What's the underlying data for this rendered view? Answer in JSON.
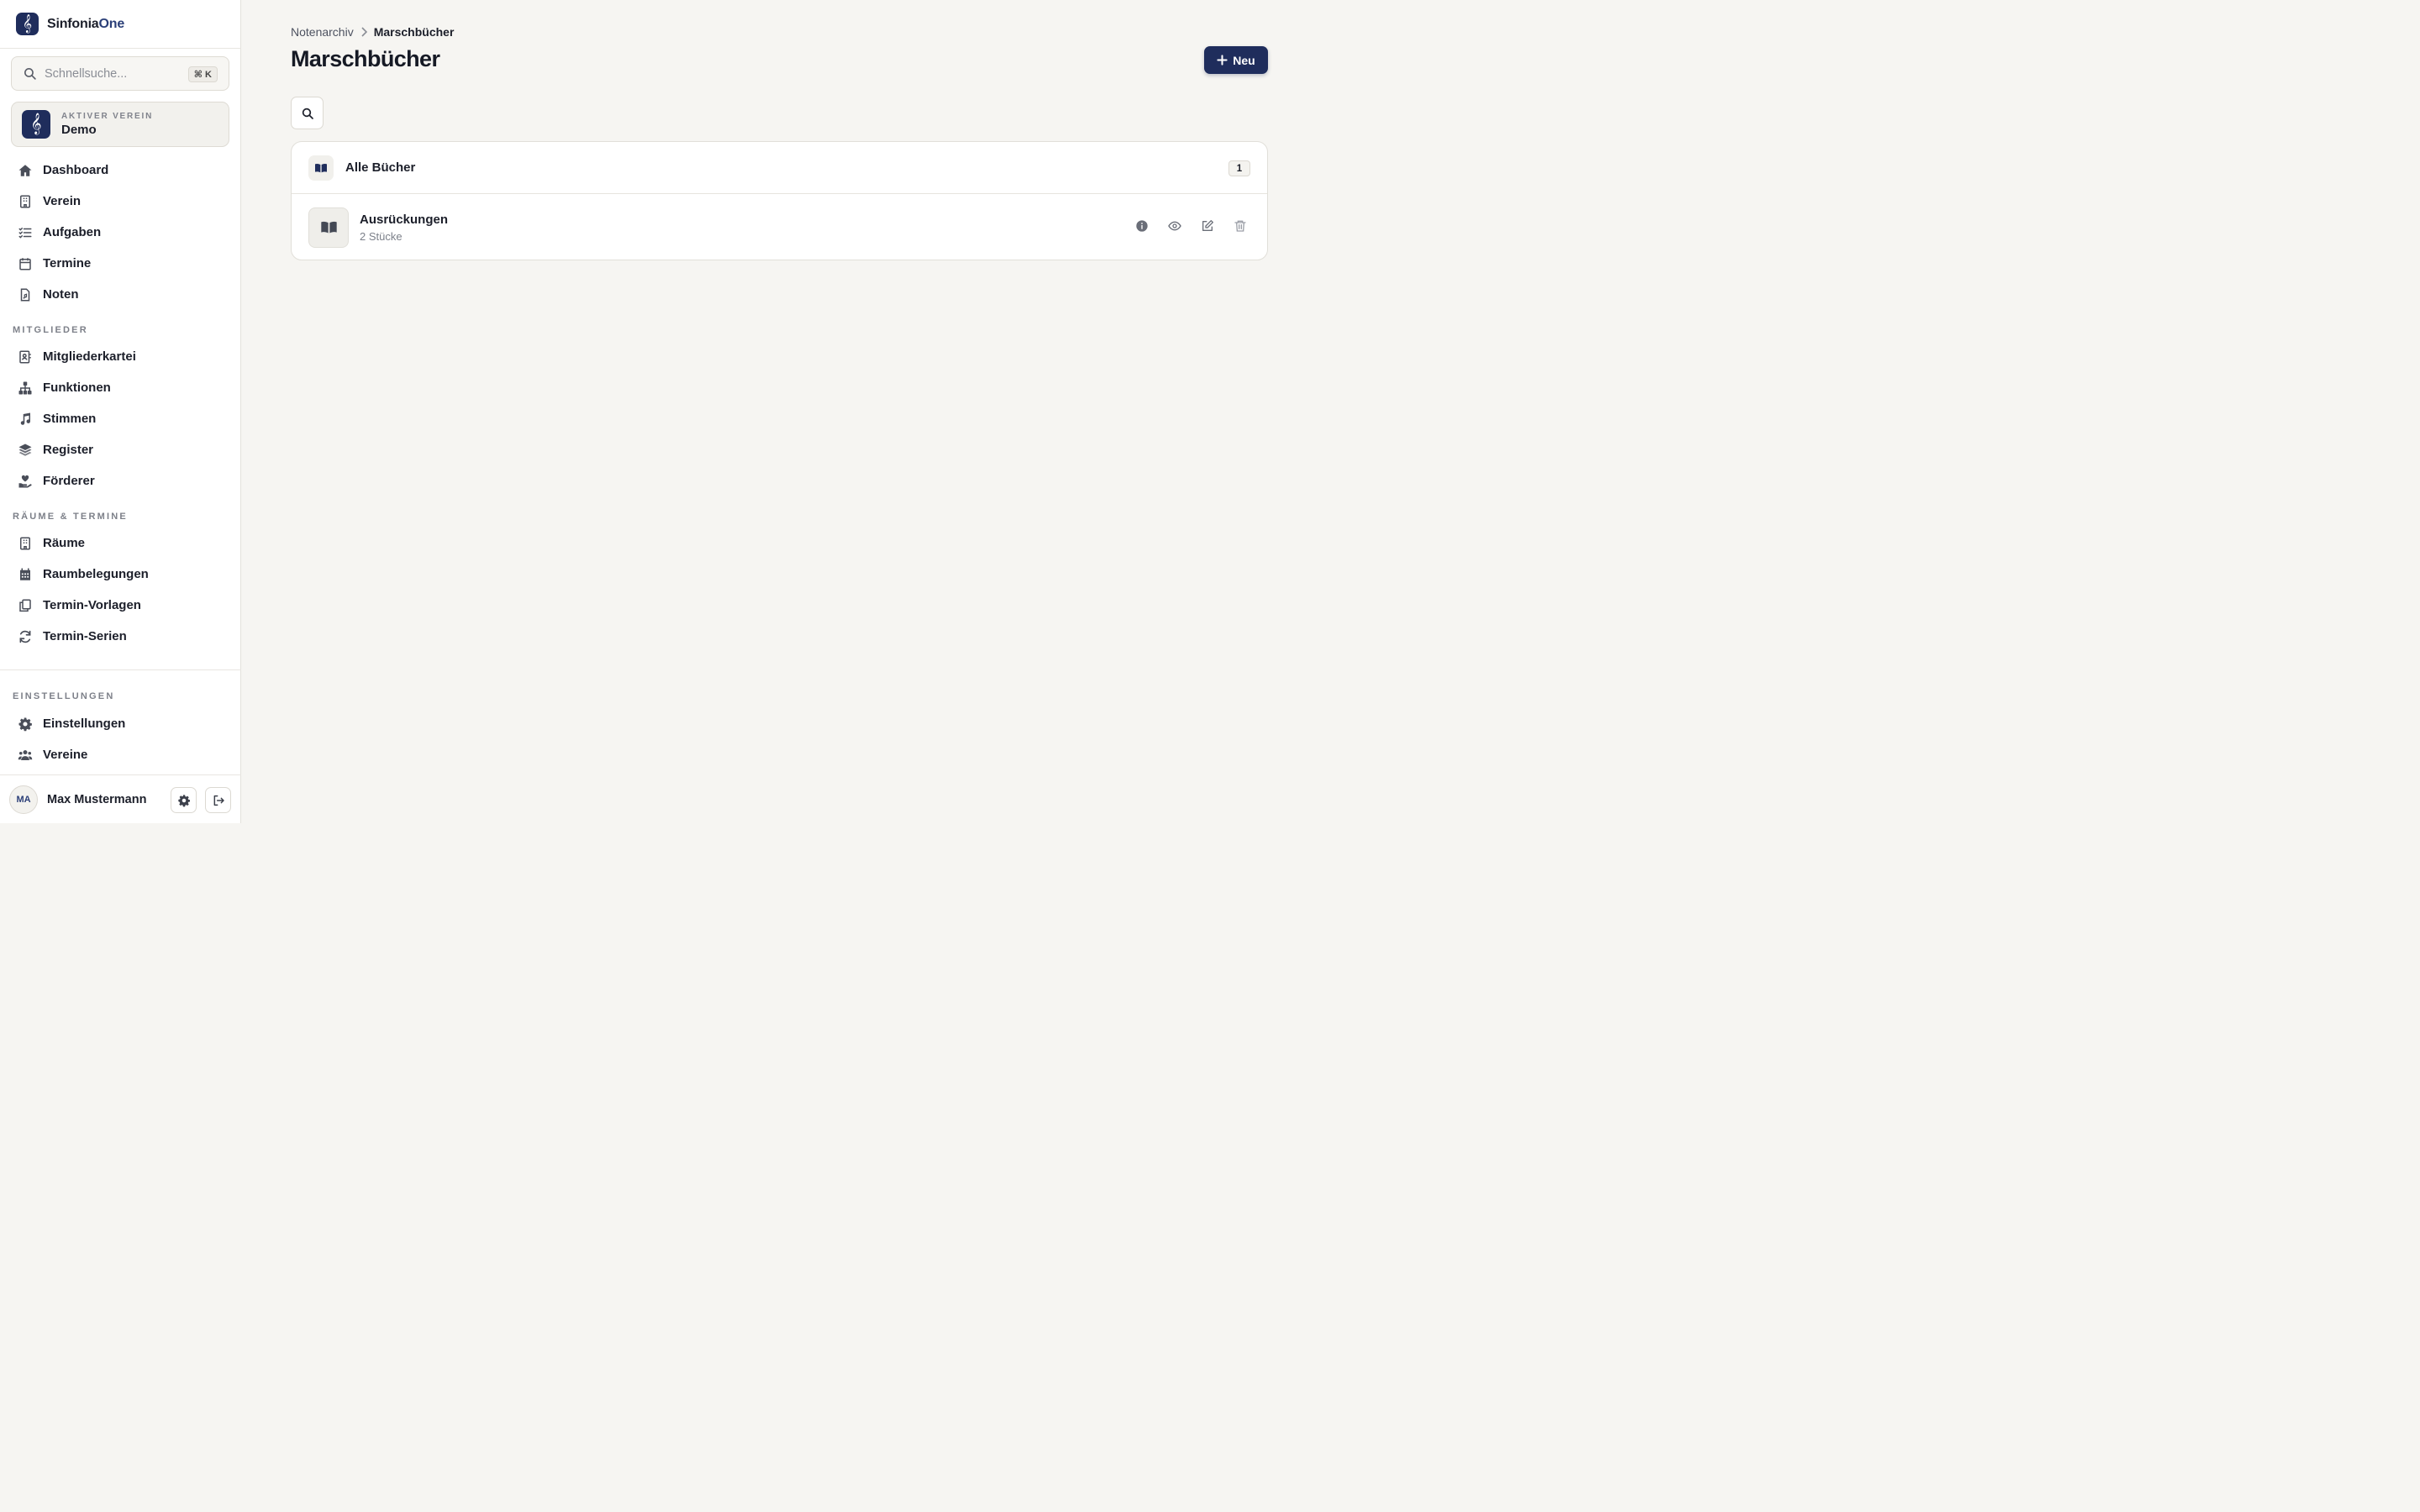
{
  "app": {
    "brand_main": "Sinfonia",
    "brand_accent": "One",
    "logo_glyph": "𝄞"
  },
  "search": {
    "placeholder": "Schnellsuche...",
    "shortcut": "⌘ K"
  },
  "club": {
    "kicker": "AKTIVER VEREIN",
    "name": "Demo",
    "logo_glyph": "𝄞"
  },
  "nav": {
    "main": [
      {
        "label": "Dashboard",
        "icon": "home-icon"
      },
      {
        "label": "Verein",
        "icon": "building-icon"
      },
      {
        "label": "Aufgaben",
        "icon": "checklist-icon"
      },
      {
        "label": "Termine",
        "icon": "calendar-icon"
      },
      {
        "label": "Noten",
        "icon": "sheet-music-file-icon"
      }
    ],
    "sections": {
      "members": "MITGLIEDER",
      "rooms": "RÄUME & TERMINE",
      "settings": "EINSTELLUNGEN"
    },
    "members": [
      {
        "label": "Mitgliederkartei",
        "icon": "contact-card-icon"
      },
      {
        "label": "Funktionen",
        "icon": "org-chart-icon"
      },
      {
        "label": "Stimmen",
        "icon": "music-note-icon"
      },
      {
        "label": "Register",
        "icon": "layers-icon"
      },
      {
        "label": "Förderer",
        "icon": "hand-heart-icon"
      }
    ],
    "rooms": [
      {
        "label": "Räume",
        "icon": "building-icon"
      },
      {
        "label": "Raumbelegungen",
        "icon": "calendar-grid-icon"
      },
      {
        "label": "Termin-Vorlagen",
        "icon": "copy-icon"
      },
      {
        "label": "Termin-Serien",
        "icon": "refresh-icon"
      }
    ],
    "settings": [
      {
        "label": "Einstellungen",
        "icon": "gear-icon"
      },
      {
        "label": "Vereine",
        "icon": "users-icon"
      }
    ]
  },
  "user": {
    "initials": "MA",
    "name": "Max Mustermann"
  },
  "breadcrumb": {
    "parent": "Notenarchiv",
    "current": "Marschbücher"
  },
  "page": {
    "title": "Marschbücher",
    "new_button": "Neu"
  },
  "books": {
    "header_title": "Alle Bücher",
    "count": "1",
    "items": [
      {
        "title": "Ausrückungen",
        "subtitle": "2 Stücke"
      }
    ]
  },
  "colors": {
    "primary": "#1f2d5c",
    "background": "#f6f5f2"
  }
}
